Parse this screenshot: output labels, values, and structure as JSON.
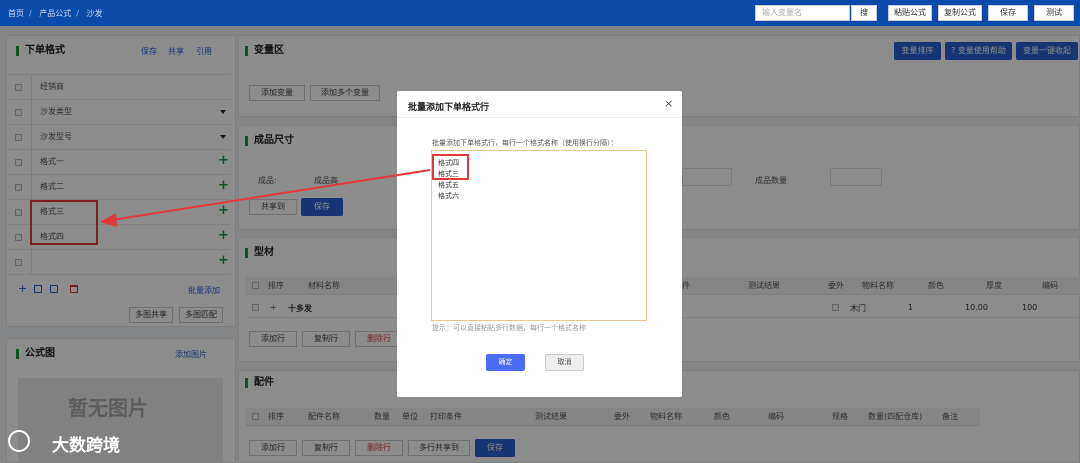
{
  "header": {
    "breadcrumb": [
      "首页",
      "产品公式",
      "沙发"
    ],
    "search_placeholder": "输入变量名",
    "search_button": "搜",
    "buttons": [
      "粘贴公式",
      "复制公式",
      "保存",
      "测试"
    ]
  },
  "order_panel": {
    "title": "下单格式",
    "actions": [
      "保存",
      "共享",
      "引用"
    ],
    "rows": [
      {
        "label": "经销商",
        "marker": ""
      },
      {
        "label": "沙发类型",
        "marker": "dropdown"
      },
      {
        "label": "沙发型号",
        "marker": "dropdown"
      },
      {
        "label": "格式一",
        "marker": "plus"
      },
      {
        "label": "格式二",
        "marker": "plus"
      },
      {
        "label": "格式三",
        "marker": "plus"
      },
      {
        "label": "格式四",
        "marker": "plus"
      },
      {
        "label": "",
        "marker": "plus"
      }
    ],
    "batch_add": "批量添加",
    "buttons": [
      "多图共享",
      "多图匹配"
    ],
    "plus_glyph": "+"
  },
  "formula_panel": {
    "title": "公式图",
    "add_image": "添加图片",
    "placeholder": "暂无图片"
  },
  "variable_panel": {
    "title": "变量区",
    "buttons": [
      "添加变量",
      "添加多个变量"
    ],
    "top_buttons": [
      "变量排序",
      "? 变量使用帮助",
      "变量一键收起"
    ]
  },
  "size_panel": {
    "title": "成品尺寸",
    "fields": [
      "成品:",
      "成品高",
      "成品数量"
    ],
    "buttons": [
      "共享到",
      "保存"
    ]
  },
  "profile_panel": {
    "title": "型材",
    "headers": [
      "排序",
      "材料名称",
      "件",
      "测试结果",
      "委外",
      "物料名称",
      "颜色",
      "厚度",
      "编码"
    ],
    "row": {
      "sort": "÷",
      "name": "十多发",
      "material": "木门",
      "qty": "1",
      "thickness": "10.00",
      "code": "100"
    },
    "buttons": [
      "添加行",
      "复制行",
      "删除行"
    ]
  },
  "parts_panel": {
    "title": "配件",
    "headers": [
      "排序",
      "配件名称",
      "数量",
      "单位",
      "打印条件",
      "测试结果",
      "委外",
      "物料名称",
      "颜色",
      "编码",
      "规格",
      "数量(四配仓库)",
      "备注"
    ],
    "buttons": [
      "添加行",
      "复制行",
      "删除行",
      "多行共享到",
      "保存"
    ]
  },
  "modal": {
    "title": "批量添加下单格式行",
    "instruction": "批量添加下单格式行，每行一个格式名称（使用换行分隔）：",
    "lines": [
      "格式四",
      "格式三",
      "格式五",
      "格式六"
    ],
    "hint": "提示：可以直接粘贴多行数据，每行一个格式名称",
    "confirm": "确定",
    "cancel": "取消",
    "close": "×"
  },
  "watermark": "大数跨境",
  "colors": {
    "header": "#0a4aa8",
    "accent_green": "#1a9a3a",
    "primary": "#2a5fd6",
    "highlight": "#e23a3a"
  }
}
